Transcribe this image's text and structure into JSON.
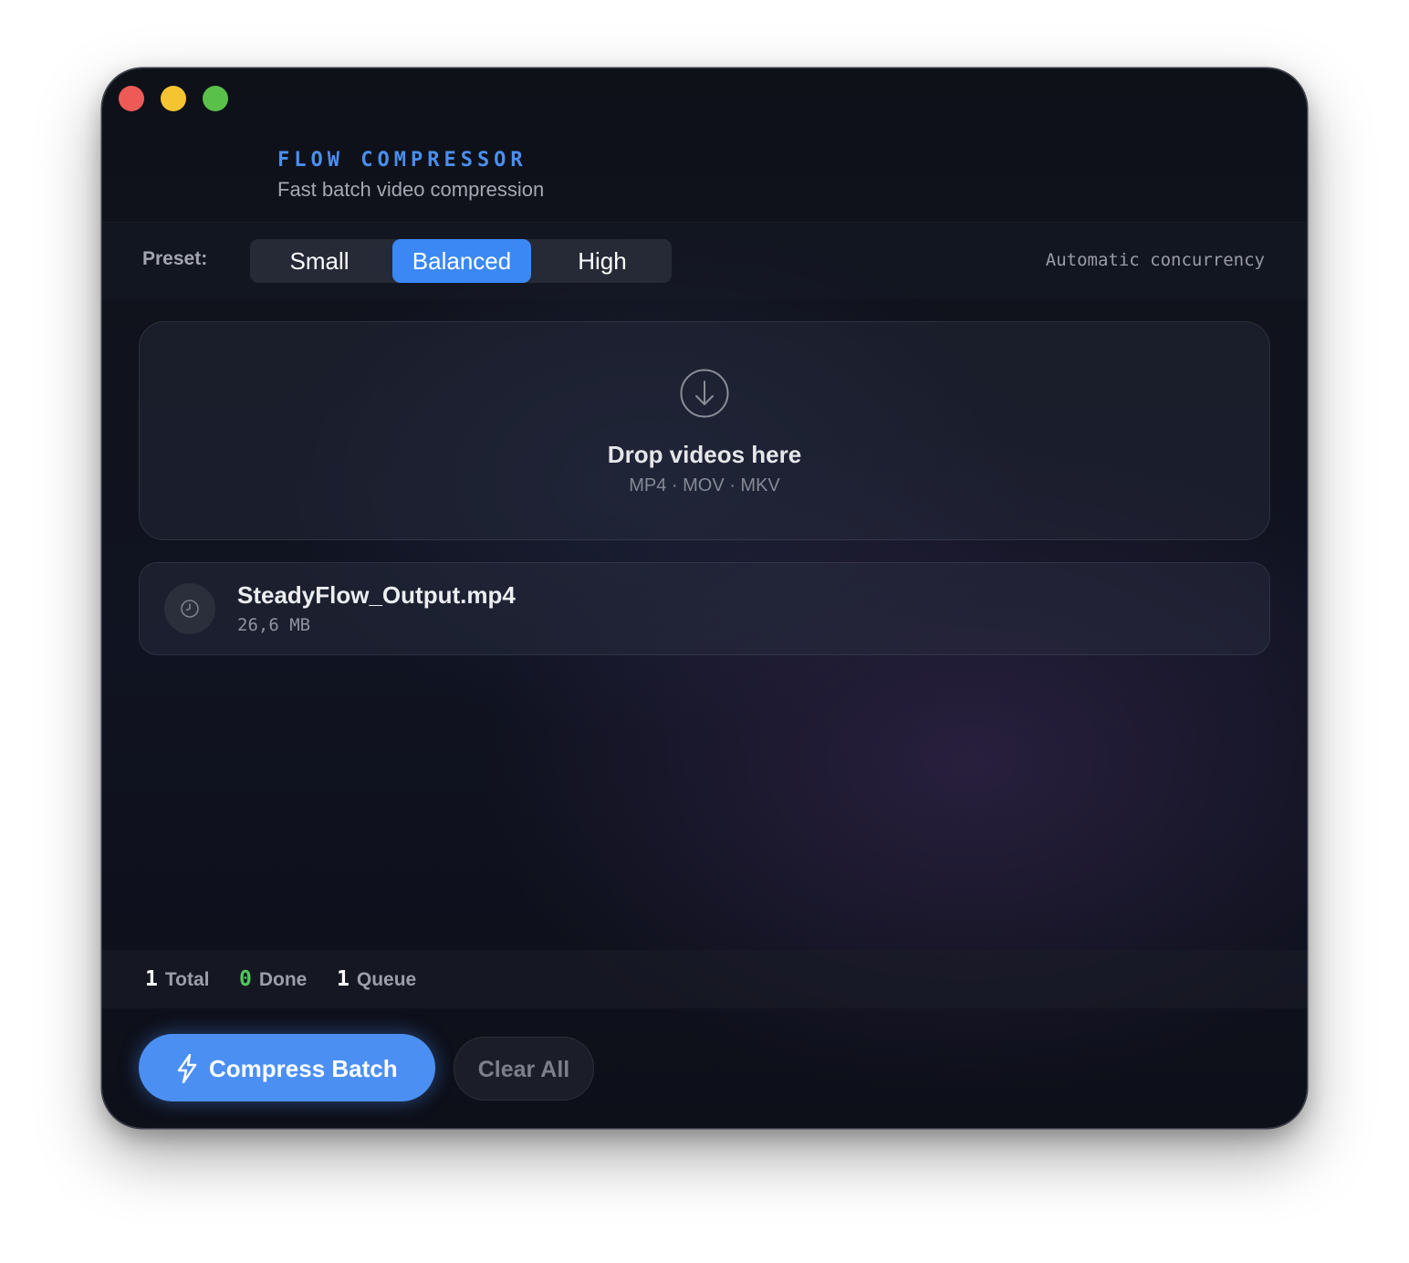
{
  "app": {
    "title": "FLOW COMPRESSOR",
    "subtitle": "Fast batch video compression"
  },
  "toolbar": {
    "preset_label": "Preset:",
    "presets": [
      {
        "label": "Small",
        "selected": false
      },
      {
        "label": "Balanced",
        "selected": true
      },
      {
        "label": "High",
        "selected": false
      }
    ],
    "concurrency": "Automatic concurrency"
  },
  "dropzone": {
    "icon": "arrow-down-circle-icon",
    "title": "Drop videos here",
    "formats": "MP4 · MOV · MKV"
  },
  "files": [
    {
      "name": "SteadyFlow_Output.mp4",
      "size": "26,6 MB",
      "status_icon": "clock-icon"
    }
  ],
  "stats": {
    "total": {
      "value": "1",
      "label": "Total"
    },
    "done": {
      "value": "0",
      "label": "Done"
    },
    "queue": {
      "value": "1",
      "label": "Queue"
    }
  },
  "actions": {
    "compress_label": "Compress Batch",
    "compress_icon": "bolt-icon",
    "clear_label": "Clear All"
  },
  "colors": {
    "accent": "#4b8ff2",
    "done_green": "#4fc85a",
    "traffic_red": "#ee5b56",
    "traffic_yellow": "#f4c431",
    "traffic_green": "#59c14a"
  }
}
